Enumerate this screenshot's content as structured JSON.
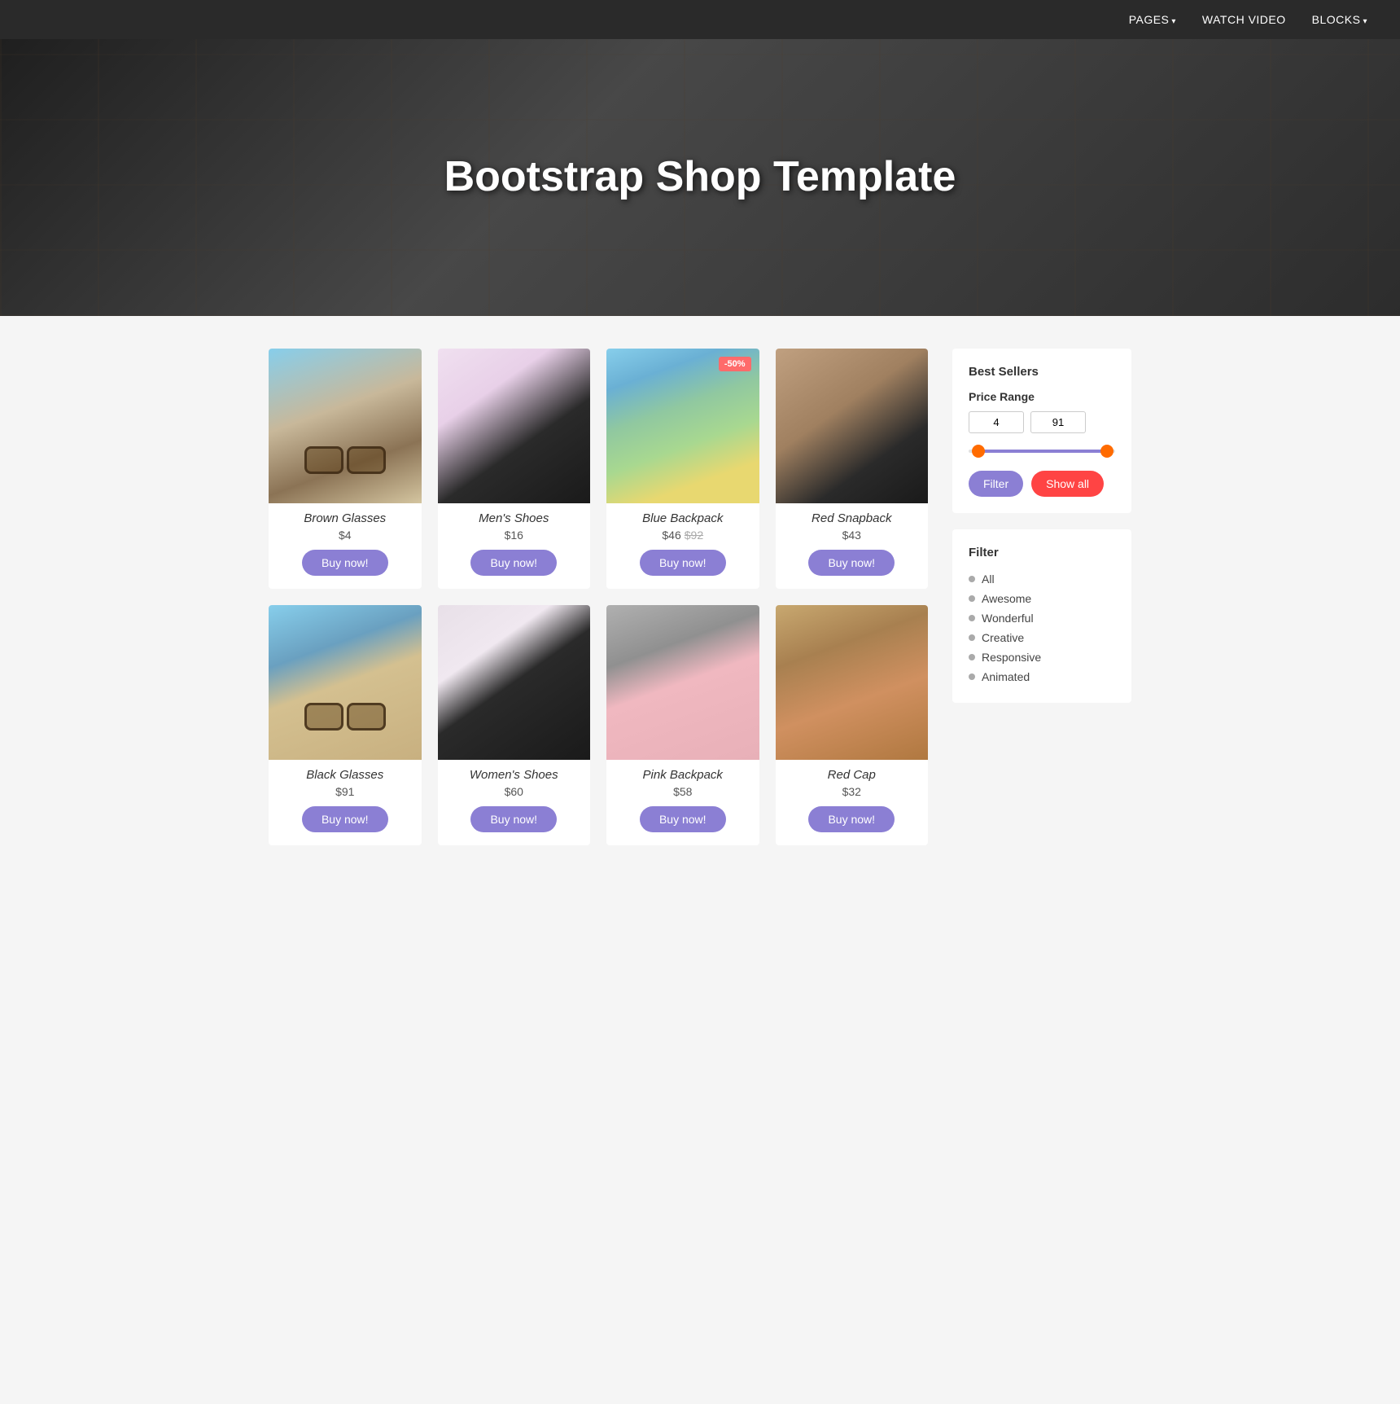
{
  "navbar": {
    "pages_label": "PAGES",
    "watch_video_label": "WATCH VIDEO",
    "blocks_label": "BLOCKS"
  },
  "hero": {
    "title": "Bootstrap Shop Template"
  },
  "products": [
    {
      "id": "brown-glasses",
      "name": "Brown Glasses",
      "price": "$4",
      "original_price": null,
      "discount": null,
      "img_class": "img-brown-glasses",
      "buy_label": "Buy now!"
    },
    {
      "id": "mens-shoes",
      "name": "Men's Shoes",
      "price": "$16",
      "original_price": null,
      "discount": null,
      "img_class": "img-mens-shoes",
      "buy_label": "Buy now!"
    },
    {
      "id": "blue-backpack",
      "name": "Blue Backpack",
      "price": "$46",
      "original_price": "$92",
      "discount": "-50%",
      "img_class": "img-blue-backpack",
      "buy_label": "Buy now!"
    },
    {
      "id": "red-snapback",
      "name": "Red Snapback",
      "price": "$43",
      "original_price": null,
      "discount": null,
      "img_class": "img-red-snapback",
      "buy_label": "Buy now!"
    },
    {
      "id": "black-glasses",
      "name": "Black Glasses",
      "price": "$91",
      "original_price": null,
      "discount": null,
      "img_class": "img-black-glasses",
      "buy_label": "Buy now!"
    },
    {
      "id": "womens-shoes",
      "name": "Women's Shoes",
      "price": "$60",
      "original_price": null,
      "discount": null,
      "img_class": "img-womens-shoes",
      "buy_label": "Buy now!"
    },
    {
      "id": "pink-backpack",
      "name": "Pink Backpack",
      "price": "$58",
      "original_price": null,
      "discount": null,
      "img_class": "img-pink-backpack",
      "buy_label": "Buy now!"
    },
    {
      "id": "red-cap",
      "name": "Red Cap",
      "price": "$32",
      "original_price": null,
      "discount": null,
      "img_class": "img-red-cap",
      "buy_label": "Buy now!"
    }
  ],
  "sidebar": {
    "best_sellers_label": "Best Sellers",
    "price_range_label": "Price Range",
    "price_min": "4",
    "price_max": "91",
    "filter_button_label": "Filter",
    "show_all_button_label": "Show all",
    "filter_title": "Filter",
    "filter_items": [
      {
        "id": "all",
        "label": "All"
      },
      {
        "id": "awesome",
        "label": "Awesome"
      },
      {
        "id": "wonderful",
        "label": "Wonderful"
      },
      {
        "id": "creative",
        "label": "Creative"
      },
      {
        "id": "responsive",
        "label": "Responsive"
      },
      {
        "id": "animated",
        "label": "Animated"
      }
    ]
  }
}
